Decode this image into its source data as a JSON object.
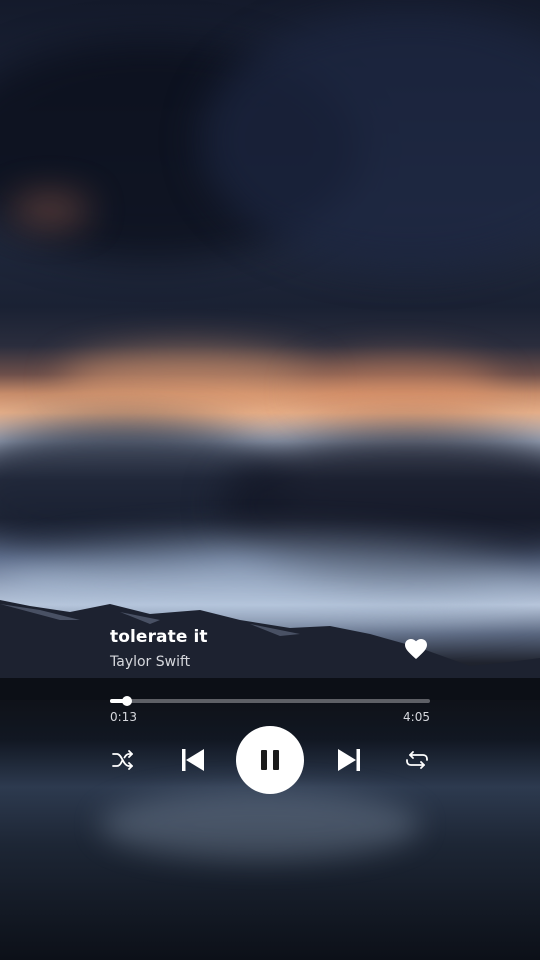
{
  "player": {
    "track_title": "tolerate it",
    "artist": "Taylor Swift",
    "time_elapsed": "0:13",
    "time_total": "4:05",
    "progress_fraction": 0.053,
    "liked": true,
    "state": "playing"
  },
  "icons": {
    "like": "heart-icon",
    "shuffle": "shuffle-icon",
    "previous": "skip-previous-icon",
    "play_pause": "pause-icon",
    "next": "skip-next-icon",
    "repeat": "repeat-icon"
  },
  "colors": {
    "foreground": "#ffffff",
    "secondary_text": "#d6d8dd",
    "track_background": "#a0a0a5",
    "pause_glyph": "#1c1c1c"
  }
}
